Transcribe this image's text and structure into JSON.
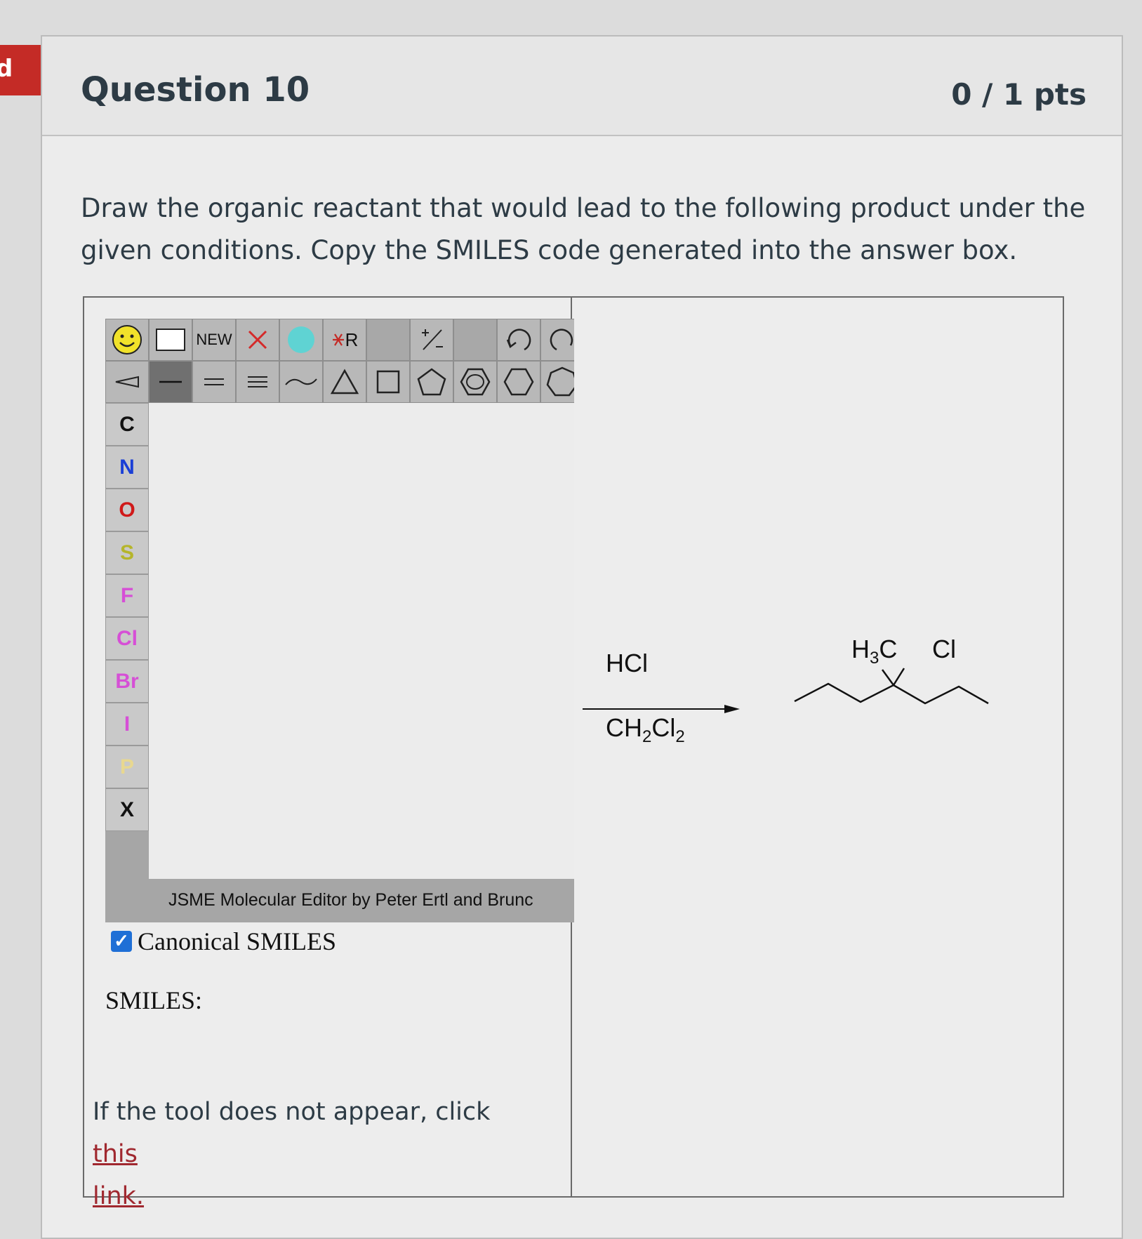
{
  "side_ribbon": {
    "text": "d",
    "color": "#c42b26"
  },
  "question": {
    "title": "Question 10",
    "points": "0 / 1 pts",
    "text": "Draw the organic reactant that would lead to the following product under the given conditions.  Copy the SMILES code generated into the answer box."
  },
  "editor": {
    "toolbar_row1": [
      {
        "name": "smiley-icon"
      },
      {
        "name": "select-box-icon"
      },
      {
        "name": "new-button",
        "label": "NEW"
      },
      {
        "name": "delete-x-icon"
      },
      {
        "name": "mark-atom-icon"
      },
      {
        "name": "r-group-icon",
        "label": "R"
      },
      {
        "name": "blank"
      },
      {
        "name": "charge-icon",
        "label": "+/−"
      },
      {
        "name": "blank"
      },
      {
        "name": "undo-icon"
      },
      {
        "name": "redo-icon"
      }
    ],
    "toolbar_row2": [
      "stereo-bond-icon",
      "single-bond-icon",
      "double-bond-icon",
      "triple-bond-icon",
      "chain-icon",
      "cyclopropane-icon",
      "cyclobutane-icon",
      "cyclopentane-icon",
      "benzene-icon",
      "cyclohexane-icon",
      "cycloheptane-icon"
    ],
    "atoms": [
      {
        "symbol": "C",
        "color": "#111111"
      },
      {
        "symbol": "N",
        "color": "#1a3fd6"
      },
      {
        "symbol": "O",
        "color": "#d01919"
      },
      {
        "symbol": "S",
        "color": "#b5b52a"
      },
      {
        "symbol": "F",
        "color": "#d64fd6"
      },
      {
        "symbol": "Cl",
        "color": "#d64fd6"
      },
      {
        "symbol": "Br",
        "color": "#d64fd6"
      },
      {
        "symbol": "I",
        "color": "#d64fd6"
      },
      {
        "symbol": "P",
        "color": "#e8d890"
      },
      {
        "symbol": "X",
        "color": "#111111"
      }
    ],
    "footer": "JSME Molecular Editor by Peter Ertl and Brunc"
  },
  "canonical_smiles": {
    "label": "Canonical SMILES",
    "checked": true
  },
  "smiles_label": "SMILES:",
  "fallback": {
    "prefix": "If the tool does not appear, click ",
    "link_text": "this",
    "link_text2": "link."
  },
  "reaction": {
    "reagent_above": "HCl",
    "solvent_below_main": "CH",
    "solvent_sub1": "2",
    "solvent_mid": "Cl",
    "solvent_sub2": "2",
    "product_label_left": "H",
    "product_label_left_sub": "3",
    "product_label_left_end": "C",
    "product_label_right": "Cl"
  }
}
